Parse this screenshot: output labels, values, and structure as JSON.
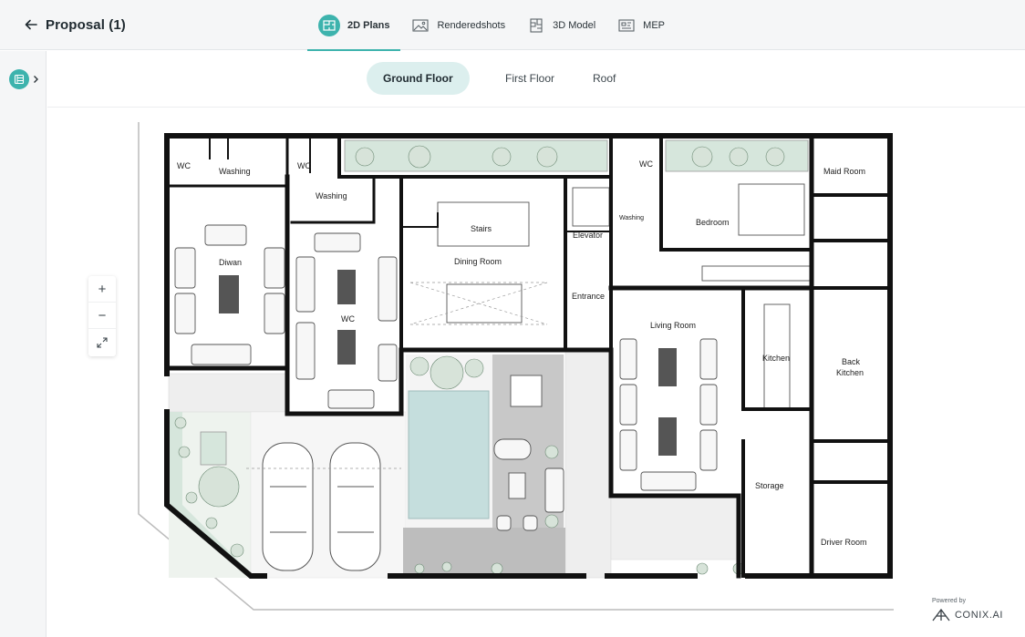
{
  "header": {
    "title": "Proposal (1)",
    "tabs": [
      {
        "label": "2D Plans",
        "icon": "floorplan-icon",
        "active": true
      },
      {
        "label": "Renderedshots",
        "icon": "image-icon",
        "active": false
      },
      {
        "label": "3D Model",
        "icon": "cube-icon",
        "active": false
      },
      {
        "label": "MEP",
        "icon": "mep-icon",
        "active": false
      }
    ]
  },
  "floors": [
    {
      "label": "Ground Floor",
      "active": true
    },
    {
      "label": "First Floor",
      "active": false
    },
    {
      "label": "Roof",
      "active": false
    }
  ],
  "zoom": {
    "in": "+",
    "out": "−"
  },
  "rooms": {
    "wc1": "WC",
    "washing1": "Washing",
    "wc2": "WC",
    "washing2": "Washing",
    "diwan": "Diwan",
    "wc3": "WC",
    "stairs": "Stairs",
    "dining": "Dining Room",
    "elevator": "Elevator",
    "entrance": "Entrance",
    "wc4": "WC",
    "washing3": "Washing",
    "bedroom": "Bedroom",
    "maid": "Maid Room",
    "living": "Living Room",
    "kitchen": "Kitchen",
    "back_kitchen_1": "Back",
    "back_kitchen_2": "Kitchen",
    "storage": "Storage",
    "driver": "Driver Room"
  },
  "branding": {
    "powered": "Powered by",
    "name": "CONIX.AI"
  },
  "colors": {
    "accent": "#3db3ad",
    "wall": "#111111",
    "pool": "#c5dedd",
    "greenery": "#d6e6dc",
    "deck": "#bfbfbf"
  }
}
